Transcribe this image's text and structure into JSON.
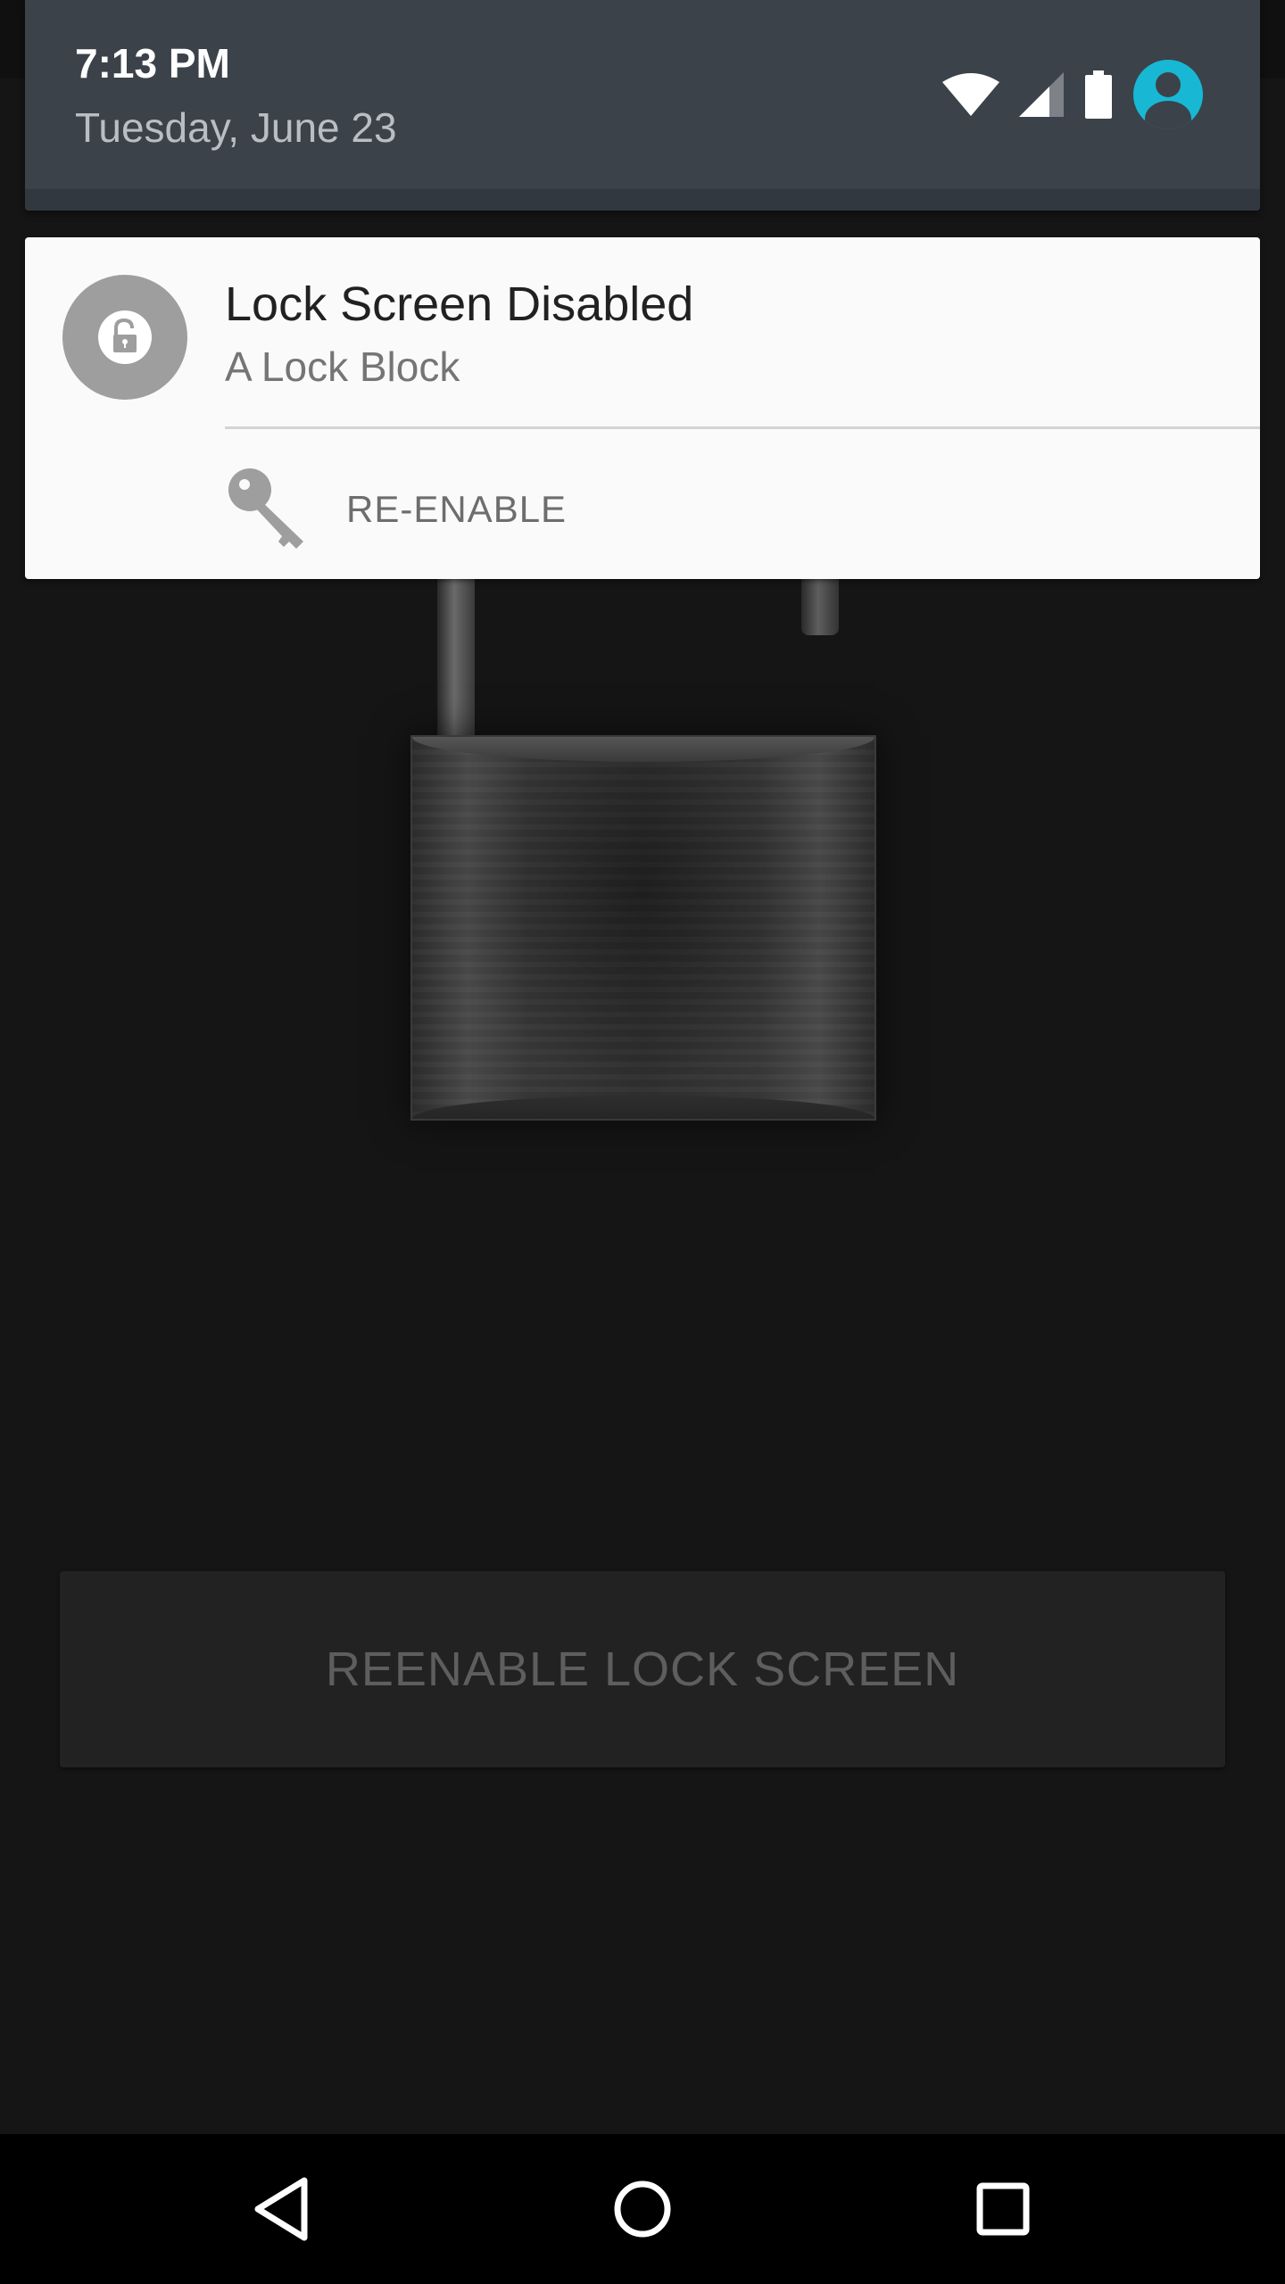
{
  "status_bar": {
    "time": "7:13 PM",
    "date": "Tuesday, June 23",
    "icons": [
      "wifi-icon",
      "cell-signal-icon",
      "battery-icon",
      "user-avatar-icon"
    ],
    "avatar_color": "#18b8d4"
  },
  "notification": {
    "icon": "unlocked-padlock-icon",
    "title": "Lock Screen Disabled",
    "text": "A Lock Block",
    "action": {
      "icon": "key-icon",
      "label": "RE-ENABLE"
    }
  },
  "app": {
    "illustration": "open-padlock-graphic",
    "button_label": "REENABLE LOCK SCREEN"
  },
  "nav_bar": {
    "buttons": [
      "back-icon",
      "home-icon",
      "recents-icon"
    ]
  }
}
